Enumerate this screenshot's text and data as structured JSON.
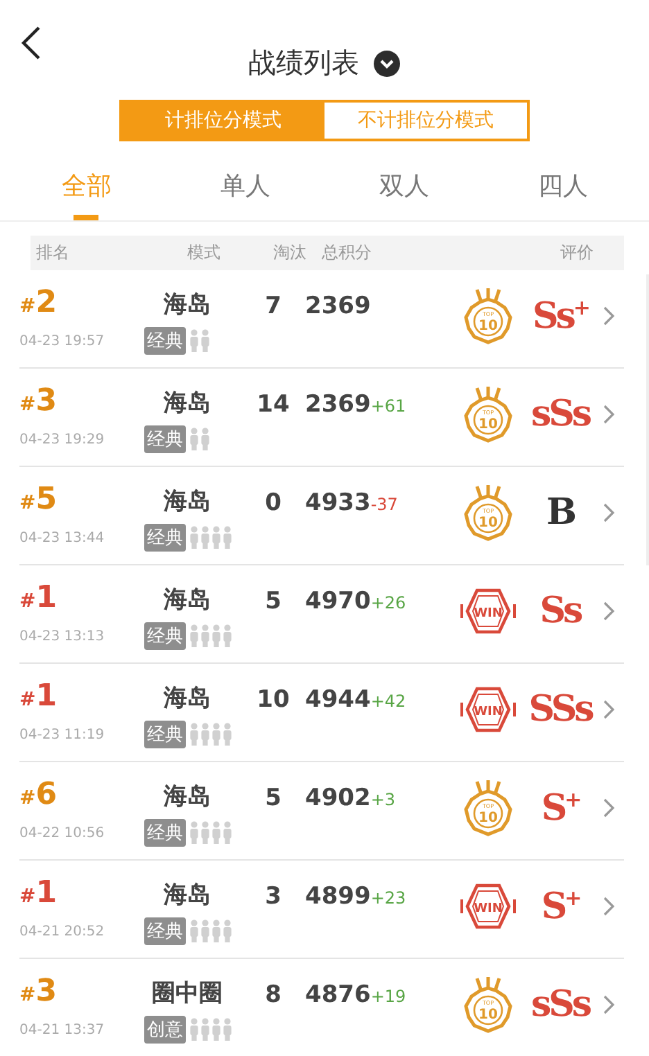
{
  "header": {
    "title": "战绩列表"
  },
  "modes": [
    {
      "label": "计排位分模式",
      "selected": true
    },
    {
      "label": "不计排位分模式",
      "selected": false
    }
  ],
  "tabs": [
    {
      "label": "全部",
      "selected": true
    },
    {
      "label": "单人",
      "selected": false
    },
    {
      "label": "双人",
      "selected": false
    },
    {
      "label": "四人",
      "selected": false
    }
  ],
  "columns": [
    "排名",
    "模式",
    "淘汰",
    "总积分",
    "评价"
  ],
  "rows": [
    {
      "rank_mark": "#",
      "rank": "2",
      "color": "#e08a14",
      "time": "04-23 19:57",
      "map": "海岛",
      "tag": "经典",
      "players": {
        "kind": "duo"
      },
      "kills": "7",
      "score": "2369",
      "badge": {
        "kind": "top10",
        "top": "TOP",
        "text": "10"
      },
      "rating": {
        "kind": "s",
        "text": "Ss$^{+}$"
      }
    },
    {
      "rank_mark": "#",
      "rank": "3",
      "color": "#e08a14",
      "time": "04-23 19:29",
      "map": "海岛",
      "tag": "经典",
      "players": {
        "kind": "duo"
      },
      "kills": "14",
      "score": "2369",
      "delta": "+61",
      "badge": {
        "kind": "top10",
        "top": "TOP",
        "text": "10"
      },
      "rating": {
        "kind": "s",
        "text": "sSs"
      }
    },
    {
      "rank_mark": "#",
      "rank": "5",
      "color": "#e08a14",
      "time": "04-23 13:44",
      "map": "海岛",
      "tag": "经典",
      "players": {
        "kind": "squad"
      },
      "kills": "0",
      "score": "4933",
      "delta": "-37",
      "badge": {
        "kind": "top10",
        "top": "TOP",
        "text": "10"
      },
      "rating": {
        "kind": "b",
        "text": "B"
      }
    },
    {
      "rank_mark": "#",
      "rank": "1",
      "color": "#d9493a",
      "time": "04-23 13:13",
      "map": "海岛",
      "tag": "经典",
      "players": {
        "kind": "squad"
      },
      "kills": "5",
      "score": "4970",
      "delta": "+26",
      "badge": {
        "kind": "win",
        "text": "WIN"
      },
      "rating": {
        "kind": "s",
        "text": "Ss"
      }
    },
    {
      "rank_mark": "#",
      "rank": "1",
      "color": "#d9493a",
      "time": "04-23 11:19",
      "map": "海岛",
      "tag": "经典",
      "players": {
        "kind": "squad"
      },
      "kills": "10",
      "score": "4944",
      "delta": "+42",
      "badge": {
        "kind": "win",
        "text": "WIN"
      },
      "rating": {
        "kind": "s",
        "text": "SSs"
      }
    },
    {
      "rank_mark": "#",
      "rank": "6",
      "color": "#e08a14",
      "time": "04-22 10:56",
      "map": "海岛",
      "tag": "经典",
      "players": {
        "kind": "squad"
      },
      "kills": "5",
      "score": "4902",
      "delta": "+3",
      "badge": {
        "kind": "top10",
        "top": "TOP",
        "text": "10"
      },
      "rating": {
        "kind": "s",
        "text": "S$^{+}$"
      }
    },
    {
      "rank_mark": "#",
      "rank": "1",
      "color": "#d9493a",
      "time": "04-21 20:52",
      "map": "海岛",
      "tag": "经典",
      "players": {
        "kind": "squad"
      },
      "kills": "3",
      "score": "4899",
      "delta": "+23",
      "badge": {
        "kind": "win",
        "text": "WIN"
      },
      "rating": {
        "kind": "s",
        "text": "S$^{+}$"
      }
    },
    {
      "rank_mark": "#",
      "rank": "3",
      "color": "#e08a14",
      "time": "04-21 13:37",
      "map": "圈中圈",
      "tag": "创意",
      "players": {
        "kind": "squad"
      },
      "kills": "8",
      "score": "4876",
      "delta": "+19",
      "badge": {
        "kind": "top10",
        "top": "TOP",
        "text": "10"
      },
      "rating": {
        "kind": "s",
        "text": "sSs"
      }
    }
  ]
}
